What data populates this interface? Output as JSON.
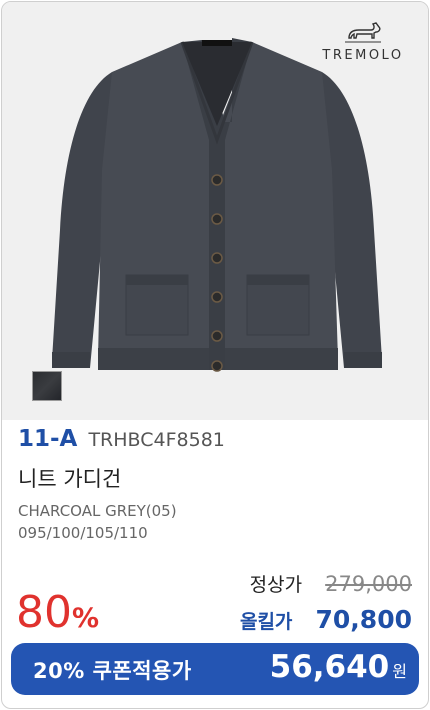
{
  "brand": {
    "name": "TREMOLO",
    "logo_icon": "dachshund-icon"
  },
  "product": {
    "swatch_color": "#2f3135",
    "model_no": "11-A",
    "code": "TRHBC4F8581",
    "name": "니트 가디건",
    "color": "CHARCOAL GREY(05)",
    "sizes": "095/100/105/110"
  },
  "pricing": {
    "discount_value": "80",
    "discount_unit": "%",
    "regular_label": "정상가",
    "regular_price": "279,000",
    "sale_label": "올킬가",
    "sale_price": "70,800"
  },
  "coupon": {
    "label": "20% 쿠폰적용가",
    "price": "56,640",
    "unit": "원"
  },
  "colors": {
    "accent_blue": "#1f4fa6",
    "coupon_bg": "#2455b3",
    "discount_red": "#e0322e"
  }
}
